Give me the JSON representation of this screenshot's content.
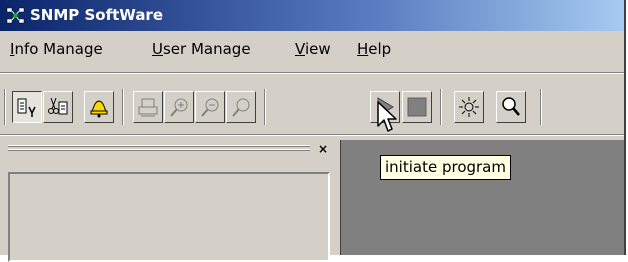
{
  "window": {
    "title": "SNMP SoftWare",
    "title_bar_color": "#0a246a",
    "face_color": "#d4d0c8"
  },
  "menubar": {
    "items": [
      {
        "label": "Info Manage",
        "mnemonic": "I",
        "rest": "nfo Manage"
      },
      {
        "label": "User Manage",
        "mnemonic": "U",
        "rest": "ser Manage"
      },
      {
        "label": "View",
        "mnemonic": "V",
        "rest": "iew"
      },
      {
        "label": "Help",
        "mnemonic": "H",
        "rest": "elp"
      }
    ]
  },
  "toolbar": {
    "buttons": [
      {
        "icon": "list-view-icon",
        "state": "pressed"
      },
      {
        "icon": "cut-list-icon",
        "state": "normal"
      },
      {
        "icon": "bell-icon",
        "state": "normal"
      },
      {
        "icon": "print-icon",
        "state": "normal"
      },
      {
        "icon": "zoom-in-icon",
        "state": "normal"
      },
      {
        "icon": "zoom-out-icon",
        "state": "normal"
      },
      {
        "icon": "zoom-icon",
        "state": "normal"
      },
      {
        "icon": "play-icon",
        "state": "hover"
      },
      {
        "icon": "stop-icon",
        "state": "disabled"
      },
      {
        "icon": "sun-icon",
        "state": "normal"
      },
      {
        "icon": "search-icon",
        "state": "normal"
      }
    ]
  },
  "left_pane": {
    "close_glyph": "×"
  },
  "tooltip": {
    "text": "initiate program"
  },
  "colors": {
    "tooltip_bg": "#ffffe1",
    "workspace": "#808080"
  }
}
